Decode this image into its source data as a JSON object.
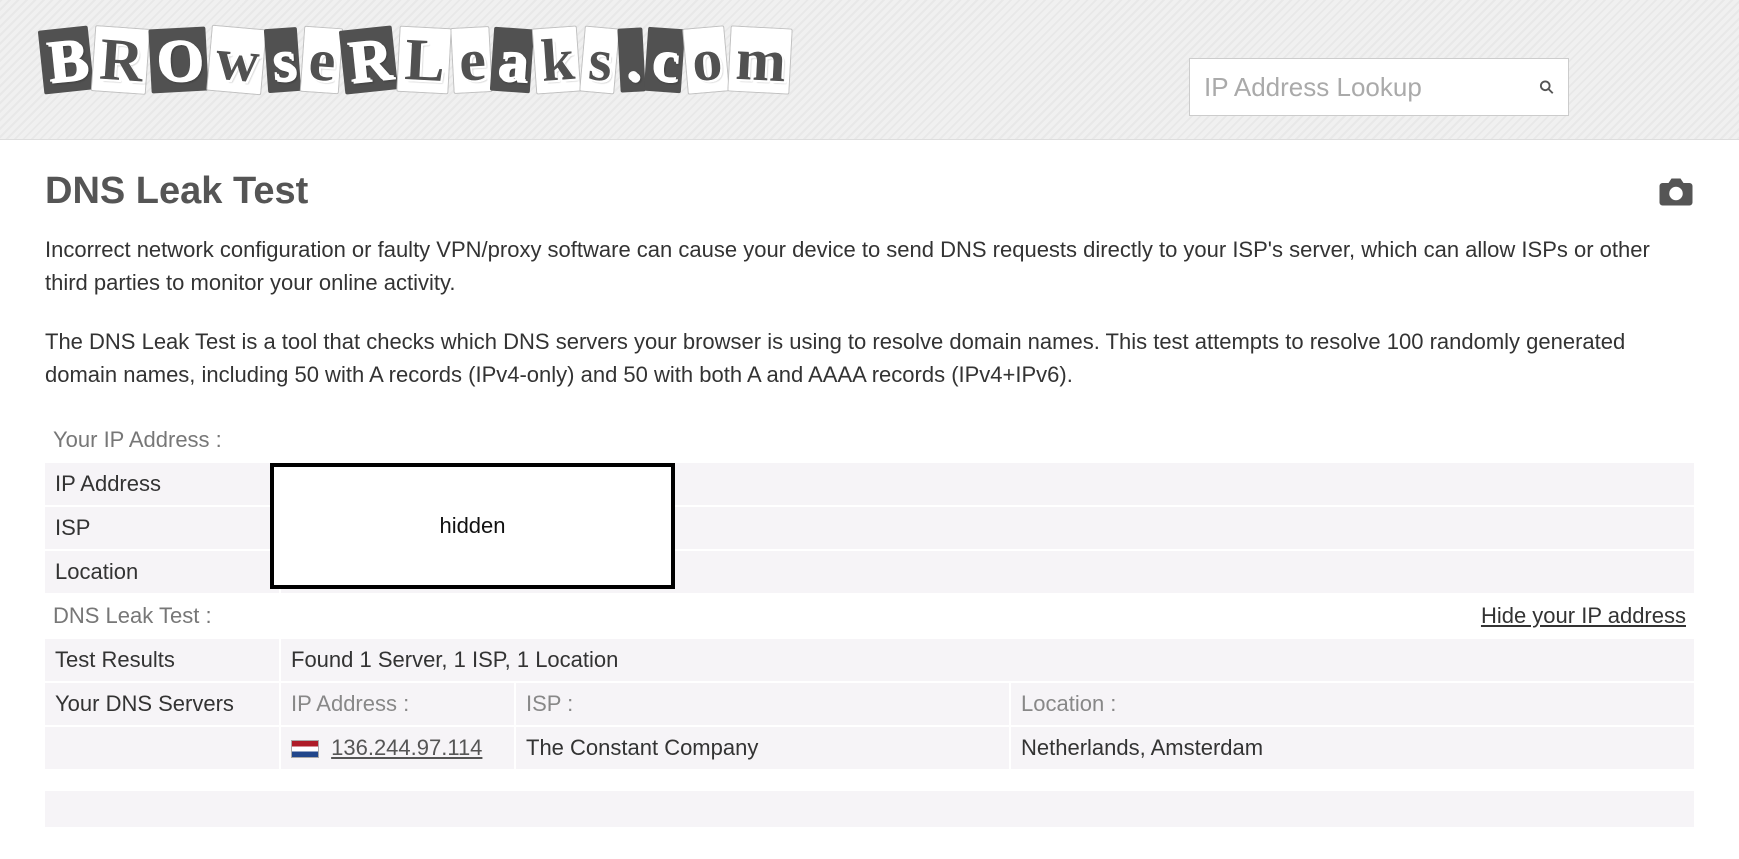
{
  "logo_text": "BROwseRLeaks.com",
  "search": {
    "placeholder": "IP Address Lookup"
  },
  "page": {
    "title": "DNS Leak Test",
    "intro1": "Incorrect network configuration or faulty VPN/proxy software can cause your device to send DNS requests directly to your ISP's server, which can allow ISPs or other third parties to monitor your online activity.",
    "intro2": "The DNS Leak Test is a tool that checks which DNS servers your browser is using to resolve domain names. This test attempts to resolve 100 randomly generated domain names, including 50 with A records (IPv4-only) and 50 with both A and AAAA records (IPv4+IPv6)."
  },
  "ip_section": {
    "header": "Your IP Address :",
    "rows": {
      "ip_label": "IP Address",
      "isp_label": "ISP",
      "loc_label": "Location"
    },
    "hidden_text": "hidden"
  },
  "dns_section": {
    "header": "DNS Leak Test :",
    "hide_link": "Hide your IP address",
    "test_results_label": "Test Results",
    "test_results_value": "Found 1 Server, 1 ISP, 1 Location",
    "servers_label": "Your DNS Servers",
    "cols": {
      "ip": "IP Address :",
      "isp": "ISP :",
      "loc": "Location :"
    },
    "server": {
      "ip": "136.244.97.114",
      "isp": "The Constant Company",
      "loc": "Netherlands, Amsterdam"
    }
  }
}
